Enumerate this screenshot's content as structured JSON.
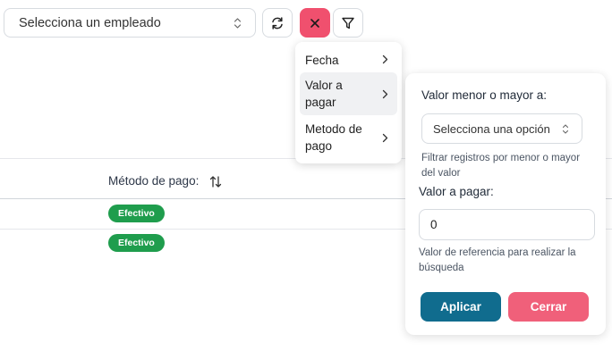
{
  "toolbar": {
    "employee_select": "Selecciona un empleado",
    "refresh_icon": "refresh-icon",
    "clear_icon": "close-icon",
    "filter_icon": "filter-icon",
    "clear_color": "#f0506e"
  },
  "table": {
    "columns": [
      {
        "label": "Método de pago:",
        "sort_icon": "sort-arrows-icon"
      }
    ],
    "rows": [
      {
        "payment_method": "Efectivo"
      },
      {
        "payment_method": "Efectivo"
      }
    ],
    "badge_color": "#1f9d4d"
  },
  "filter_menu": {
    "items": [
      {
        "label": "Fecha",
        "active": false
      },
      {
        "label": "Valor a pagar",
        "active": true
      },
      {
        "label": "Metodo de pago",
        "active": false
      }
    ]
  },
  "filter_panel": {
    "comparison_label": "Valor menor o mayor a:",
    "comparison_select": "Selecciona una opción",
    "comparison_help": "Filtrar registros por menor o mayor del valor",
    "value_label": "Valor a pagar:",
    "value": "0",
    "value_help": "Valor de referencia para realizar la búsqueda",
    "apply_label": "Aplicar",
    "close_label": "Cerrar",
    "apply_color": "#106c8e",
    "close_color": "#f0607a"
  }
}
